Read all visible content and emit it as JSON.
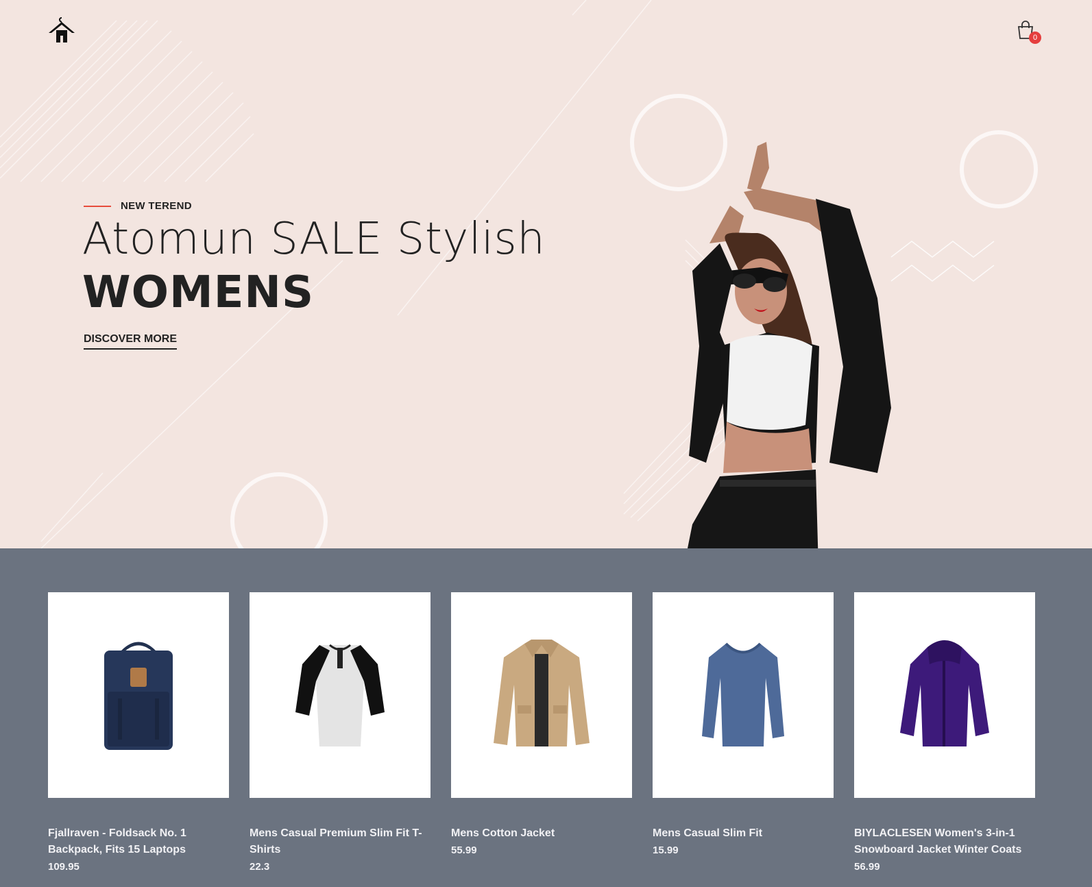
{
  "header": {
    "logo_icon": "hanger-house-icon",
    "cart_icon": "shopping-bag-icon",
    "cart_count": "0"
  },
  "hero": {
    "tagline": "NEW TEREND",
    "headline": "Atomun SALE Stylish",
    "headline_bold": "WOMENS",
    "cta": "DISCOVER MORE"
  },
  "colors": {
    "hero_bg": "#f3e5e0",
    "section_bg": "#6b7380",
    "accent": "#e74c3c",
    "badge": "#e53e3e"
  },
  "products": [
    {
      "title": "Fjallraven - Foldsack No. 1 Backpack, Fits 15 Laptops",
      "price": "109.95",
      "icon": "backpack-icon"
    },
    {
      "title": "Mens Casual Premium Slim Fit T-Shirts",
      "price": "22.3",
      "icon": "raglan-tshirt-icon"
    },
    {
      "title": "Mens Cotton Jacket",
      "price": "55.99",
      "icon": "cotton-jacket-icon"
    },
    {
      "title": "Mens Casual Slim Fit",
      "price": "15.99",
      "icon": "longsleeve-tee-icon"
    },
    {
      "title": "BIYLACLESEN Women's 3-in-1 Snowboard Jacket Winter Coats",
      "price": "56.99",
      "icon": "snowboard-jacket-icon"
    }
  ]
}
